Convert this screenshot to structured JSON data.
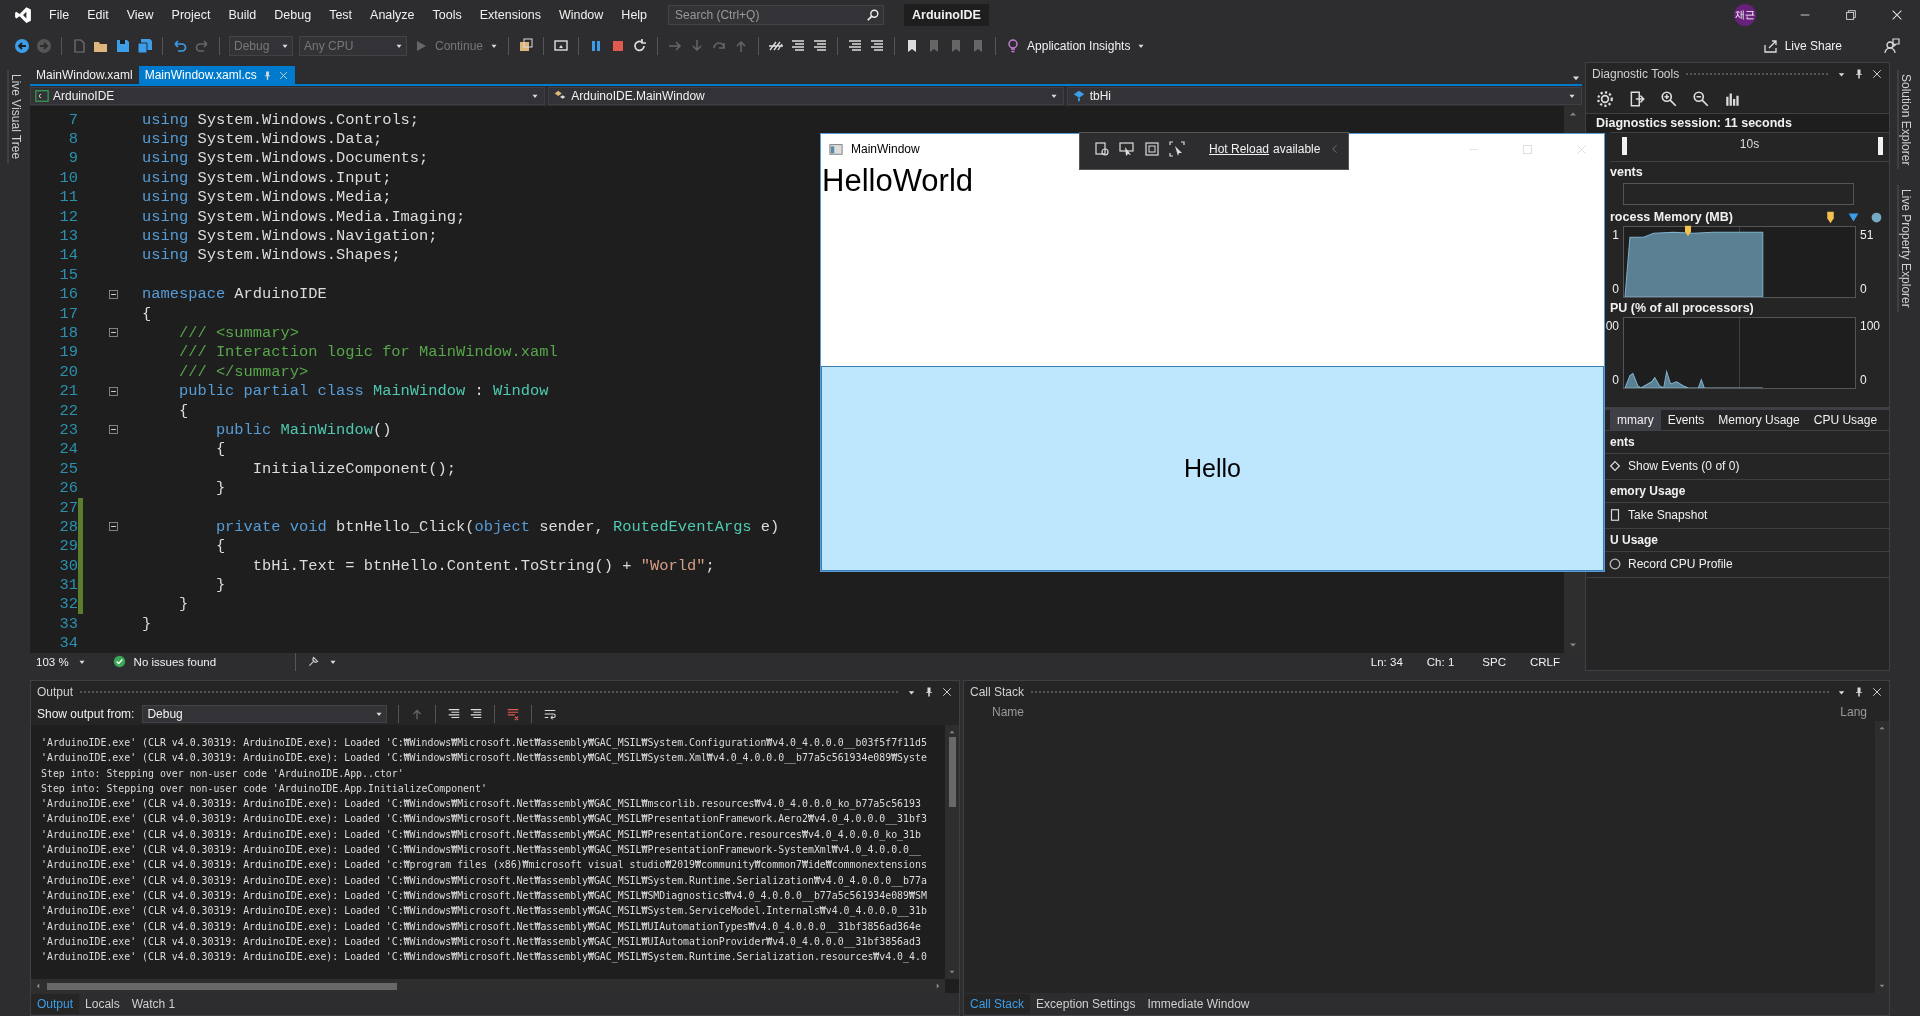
{
  "menu_bar": {
    "items": [
      "File",
      "Edit",
      "View",
      "Project",
      "Build",
      "Debug",
      "Test",
      "Analyze",
      "Tools",
      "Extensions",
      "Window",
      "Help"
    ],
    "search": {
      "placeholder": "Search (Ctrl+Q)"
    },
    "solution_title": "ArduinoIDE",
    "account_initials": "채근"
  },
  "toolbar": {
    "configuration": "Debug",
    "platform": "Any CPU",
    "continue": "Continue",
    "insights": "Application Insights",
    "live_share": "Live Share"
  },
  "left_rail": [
    "Live Visual Tree"
  ],
  "right_rail": [
    "Solution Explorer",
    "Live Property Explorer"
  ],
  "editor": {
    "tabs": [
      {
        "label": "MainWindow.xaml",
        "selected": false
      },
      {
        "label": "MainWindow.xaml.cs",
        "selected": true
      }
    ],
    "nav": [
      "ArduinoIDE",
      "ArduinoIDE.MainWindow",
      "tbHi"
    ],
    "lines": [
      {
        "number": "7",
        "fold": false,
        "modified": false,
        "tokens": [
          {
            "kind": "keyword",
            "text": "using"
          },
          {
            "kind": "plain",
            "text": " System.Windows.Controls;"
          }
        ]
      },
      {
        "number": "8",
        "fold": false,
        "modified": false,
        "tokens": [
          {
            "kind": "keyword",
            "text": "using"
          },
          {
            "kind": "plain",
            "text": " System.Windows.Data;"
          }
        ]
      },
      {
        "number": "9",
        "fold": false,
        "modified": false,
        "tokens": [
          {
            "kind": "keyword",
            "text": "using"
          },
          {
            "kind": "plain",
            "text": " System.Windows.Documents;"
          }
        ]
      },
      {
        "number": "10",
        "fold": false,
        "modified": false,
        "tokens": [
          {
            "kind": "keyword",
            "text": "using"
          },
          {
            "kind": "plain",
            "text": " System.Windows.Input;"
          }
        ]
      },
      {
        "number": "11",
        "fold": false,
        "modified": false,
        "tokens": [
          {
            "kind": "keyword",
            "text": "using"
          },
          {
            "kind": "plain",
            "text": " System.Windows.Media;"
          }
        ]
      },
      {
        "number": "12",
        "fold": false,
        "modified": false,
        "tokens": [
          {
            "kind": "keyword",
            "text": "using"
          },
          {
            "kind": "plain",
            "text": " System.Windows.Media.Imaging;"
          }
        ]
      },
      {
        "number": "13",
        "fold": false,
        "modified": false,
        "tokens": [
          {
            "kind": "keyword",
            "text": "using"
          },
          {
            "kind": "plain",
            "text": " System.Windows.Navigation;"
          }
        ]
      },
      {
        "number": "14",
        "fold": false,
        "modified": false,
        "tokens": [
          {
            "kind": "keyword",
            "text": "using"
          },
          {
            "kind": "plain",
            "text": " System.Windows.Shapes;"
          }
        ]
      },
      {
        "number": "15",
        "fold": false,
        "modified": false
      },
      {
        "number": "16",
        "fold": true,
        "modified": false,
        "tokens": [
          {
            "kind": "keyword",
            "text": "namespace"
          },
          {
            "kind": "plain",
            "text": " ArduinoIDE"
          }
        ]
      },
      {
        "number": "17",
        "fold": false,
        "modified": false,
        "tokens": [
          {
            "kind": "plain",
            "text": "{"
          }
        ]
      },
      {
        "number": "18",
        "fold": true,
        "modified": false,
        "tokens": [
          {
            "kind": "comment",
            "text": "    /// <summary>"
          }
        ]
      },
      {
        "number": "19",
        "fold": false,
        "modified": false,
        "tokens": [
          {
            "kind": "comment",
            "text": "    /// Interaction logic for MainWindow.xaml"
          }
        ]
      },
      {
        "number": "20",
        "fold": false,
        "modified": false,
        "tokens": [
          {
            "kind": "comment",
            "text": "    /// </summary>"
          }
        ]
      },
      {
        "number": "21",
        "fold": true,
        "modified": false,
        "tokens": [
          {
            "kind": "keyword",
            "text": "    public partial class "
          },
          {
            "kind": "type",
            "text": "MainWindow"
          },
          {
            "kind": "plain",
            "text": " : "
          },
          {
            "kind": "type",
            "text": "Window"
          }
        ]
      },
      {
        "number": "22",
        "fold": false,
        "modified": false,
        "tokens": [
          {
            "kind": "plain",
            "text": "    {"
          }
        ]
      },
      {
        "number": "23",
        "fold": true,
        "modified": false,
        "tokens": [
          {
            "kind": "keyword",
            "text": "        public "
          },
          {
            "kind": "type",
            "text": "MainWindow"
          },
          {
            "kind": "plain",
            "text": "()"
          }
        ]
      },
      {
        "number": "24",
        "fold": false,
        "modified": false,
        "tokens": [
          {
            "kind": "plain",
            "text": "        {"
          }
        ]
      },
      {
        "number": "25",
        "fold": false,
        "modified": false,
        "tokens": [
          {
            "kind": "plain",
            "text": "            InitializeComponent();"
          }
        ]
      },
      {
        "number": "26",
        "fold": false,
        "modified": false,
        "tokens": [
          {
            "kind": "plain",
            "text": "        }"
          }
        ]
      },
      {
        "number": "27",
        "fold": false,
        "modified": true
      },
      {
        "number": "28",
        "fold": true,
        "modified": true,
        "tokens": [
          {
            "kind": "keyword",
            "text": "        private void "
          },
          {
            "kind": "plain",
            "text": "btnHello_Click("
          },
          {
            "kind": "keyword",
            "text": "object"
          },
          {
            "kind": "plain",
            "text": " sender, "
          },
          {
            "kind": "type",
            "text": "RoutedEventArgs"
          },
          {
            "kind": "plain",
            "text": " e)"
          }
        ]
      },
      {
        "number": "29",
        "fold": false,
        "modified": true,
        "tokens": [
          {
            "kind": "plain",
            "text": "        {"
          }
        ]
      },
      {
        "number": "30",
        "fold": false,
        "modified": true,
        "tokens": [
          {
            "kind": "plain",
            "text": "            tbHi.Text = btnHello.Content.ToString() + "
          },
          {
            "kind": "string",
            "text": "\"World\""
          },
          {
            "kind": "plain",
            "text": ";"
          }
        ]
      },
      {
        "number": "31",
        "fold": false,
        "modified": true,
        "tokens": [
          {
            "kind": "plain",
            "text": "        }"
          }
        ]
      },
      {
        "number": "32",
        "fold": false,
        "modified": true,
        "tokens": [
          {
            "kind": "plain",
            "text": "    }"
          }
        ]
      },
      {
        "number": "33",
        "fold": false,
        "modified": false,
        "tokens": [
          {
            "kind": "plain",
            "text": "}"
          }
        ]
      },
      {
        "number": "34",
        "fold": false,
        "modified": false
      }
    ],
    "status": {
      "zoom": "103 %",
      "issues": "No issues found",
      "line": "Ln: 34",
      "column": "Ch: 1",
      "indent": "SPC",
      "line_ending": "CRLF"
    }
  },
  "app_window": {
    "title": "MainWindow",
    "hot_reload_link": "Hot Reload",
    "hot_reload_text": "available",
    "text_block": "HelloWorld",
    "button": "Hello"
  },
  "diagnostic_tools": {
    "title": "Diagnostic Tools",
    "session": "Diagnostics session: 11 seconds",
    "ruler_label": "10s",
    "events_label": "vents",
    "graphs": [
      {
        "kind": "memory",
        "title": "rocess Memory (MB)",
        "left_labels": [
          "1",
          "0"
        ],
        "right_labels": [
          "51",
          "0"
        ]
      },
      {
        "kind": "cpu",
        "title": "PU (% of all processors)",
        "left_labels": [
          "00",
          "0"
        ],
        "right_labels": [
          "100",
          "0"
        ]
      }
    ],
    "tabs": [
      {
        "label": "mmary",
        "selected": true
      },
      {
        "label": "Events",
        "selected": false
      },
      {
        "label": "Memory Usage",
        "selected": false
      },
      {
        "label": "CPU Usage",
        "selected": false
      }
    ],
    "sections": [
      {
        "kind": "events",
        "header": "ents",
        "action": "Show Events (0 of 0)"
      },
      {
        "kind": "snapshot",
        "header": "emory Usage",
        "action": "Take Snapshot"
      },
      {
        "kind": "record",
        "header": "U Usage",
        "action": "Record CPU Profile"
      }
    ]
  },
  "output": {
    "title": "Output",
    "source_label": "Show output from:",
    "source": "Debug",
    "lines": [
      "'ArduinoIDE.exe' (CLR v4.0.30319: ArduinoIDE.exe): Loaded 'C:₩Windows₩Microsoft.Net₩assembly₩GAC_MSIL₩System.Configuration₩v4.0_4.0.0.0__b03f5f7f11d5",
      "'ArduinoIDE.exe' (CLR v4.0.30319: ArduinoIDE.exe): Loaded 'C:₩Windows₩Microsoft.Net₩assembly₩GAC_MSIL₩System.Xml₩v4.0_4.0.0.0__b77a5c561934e089₩Syste",
      "Step into: Stepping over non-user code 'ArduinoIDE.App..ctor'",
      "Step into: Stepping over non-user code 'ArduinoIDE.App.InitializeComponent'",
      "'ArduinoIDE.exe' (CLR v4.0.30319: ArduinoIDE.exe): Loaded 'C:₩Windows₩Microsoft.Net₩assembly₩GAC_MSIL₩mscorlib.resources₩v4.0_4.0.0.0_ko_b77a5c56193",
      "'ArduinoIDE.exe' (CLR v4.0.30319: ArduinoIDE.exe): Loaded 'C:₩Windows₩Microsoft.Net₩assembly₩GAC_MSIL₩PresentationFramework.Aero2₩v4.0_4.0.0.0__31bf3",
      "'ArduinoIDE.exe' (CLR v4.0.30319: ArduinoIDE.exe): Loaded 'C:₩Windows₩Microsoft.Net₩assembly₩GAC_MSIL₩PresentationCore.resources₩v4.0_4.0.0.0_ko_31b",
      "'ArduinoIDE.exe' (CLR v4.0.30319: ArduinoIDE.exe): Loaded 'C:₩Windows₩Microsoft.Net₩assembly₩GAC_MSIL₩PresentationFramework-SystemXml₩v4.0_4.0.0.0__",
      "'ArduinoIDE.exe' (CLR v4.0.30319: ArduinoIDE.exe): Loaded 'c:₩program files (x86)₩microsoft visual studio₩2019₩community₩common7₩ide₩commonextensions",
      "'ArduinoIDE.exe' (CLR v4.0.30319: ArduinoIDE.exe): Loaded 'C:₩Windows₩Microsoft.Net₩assembly₩GAC_MSIL₩System.Runtime.Serialization₩v4.0_4.0.0.0__b77a",
      "'ArduinoIDE.exe' (CLR v4.0.30319: ArduinoIDE.exe): Loaded 'C:₩Windows₩Microsoft.Net₩assembly₩GAC_MSIL₩SMDiagnostics₩v4.0_4.0.0.0__b77a5c561934e089₩SM",
      "'ArduinoIDE.exe' (CLR v4.0.30319: ArduinoIDE.exe): Loaded 'C:₩Windows₩Microsoft.Net₩assembly₩GAC_MSIL₩System.ServiceModel.Internals₩v4.0_4.0.0.0__31b",
      "'ArduinoIDE.exe' (CLR v4.0.30319: ArduinoIDE.exe): Loaded 'C:₩Windows₩Microsoft.Net₩assembly₩GAC_MSIL₩UIAutomationTypes₩v4.0_4.0.0.0__31bf3856ad364e",
      "'ArduinoIDE.exe' (CLR v4.0.30319: ArduinoIDE.exe): Loaded 'C:₩Windows₩Microsoft.Net₩assembly₩GAC_MSIL₩UIAutomationProvider₩v4.0_4.0.0.0__31bf3856ad3",
      "'ArduinoIDE.exe' (CLR v4.0.30319: ArduinoIDE.exe): Loaded 'C:₩Windows₩Microsoft.Net₩assembly₩GAC_MSIL₩System.Runtime.Serialization.resources₩v4.0_4.0"
    ],
    "tabs": [
      {
        "label": "Output",
        "selected": true
      },
      {
        "label": "Locals",
        "selected": false
      },
      {
        "label": "Watch 1",
        "selected": false
      }
    ]
  },
  "call_stack": {
    "title": "Call Stack",
    "columns": [
      "Name",
      "Lang"
    ],
    "tabs": [
      {
        "label": "Call Stack",
        "selected": true
      },
      {
        "label": "Exception Settings",
        "selected": false
      },
      {
        "label": "Immediate Window",
        "selected": false
      }
    ]
  }
}
